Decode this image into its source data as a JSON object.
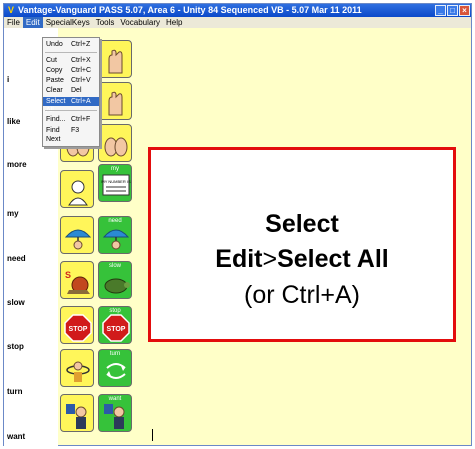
{
  "window": {
    "title": "Vantage-Vanguard PASS 5.07, Area 6 - Unity 84 Sequenced VB - 5.07 Mar 11 2011",
    "app_icon": "V",
    "buttons": [
      "_",
      "□",
      "×"
    ]
  },
  "menubar": {
    "items": [
      "File",
      "Edit",
      "SpecialKeys",
      "Tools",
      "Vocabulary",
      "Help"
    ],
    "active": "Edit"
  },
  "edit_menu": [
    {
      "label": "Undo",
      "shortcut": "Ctrl+Z"
    },
    {
      "label": "Cut",
      "shortcut": "Ctrl+X"
    },
    {
      "label": "Copy",
      "shortcut": "Ctrl+C"
    },
    {
      "label": "Paste",
      "shortcut": "Ctrl+V"
    },
    {
      "label": "Clear",
      "shortcut": "Del"
    },
    {
      "label": "Select All",
      "shortcut": "Ctrl+A"
    },
    {
      "label": "Find...",
      "shortcut": "Ctrl+F"
    },
    {
      "label": "Find Next",
      "shortcut": "F3"
    }
  ],
  "word_column": [
    "i",
    "like",
    "more",
    "my",
    "need",
    "slow",
    "stop",
    "turn",
    "want"
  ],
  "tiles": {
    "my": "my",
    "need": "need",
    "slow": "slow",
    "stop": "stop",
    "turn": "turn",
    "want": "want",
    "sign_left": "STOP",
    "sign_right": "STOP",
    "snail_letter": "S",
    "card_text": "MY NUMBER IS"
  },
  "callout": {
    "title": "Select",
    "line2_bold_left": "Edit",
    "line2_mid": ">",
    "line2_bold_right": "Select All",
    "line3": "(or Ctrl+A)"
  },
  "colors": {
    "titlebar": "#0b49c9",
    "workspace": "#ffffc8",
    "tile_yellow": "#fff65a",
    "tile_green": "#36c23a",
    "callout_border": "#e30d0d",
    "menu_highlight": "#316ac5"
  },
  "icons": [
    "app-icon",
    "minimize-icon",
    "maximize-icon",
    "close-icon",
    "stop-sign-icon",
    "snail-icon",
    "turtle-icon",
    "umbrella-icon",
    "person-icon"
  ]
}
